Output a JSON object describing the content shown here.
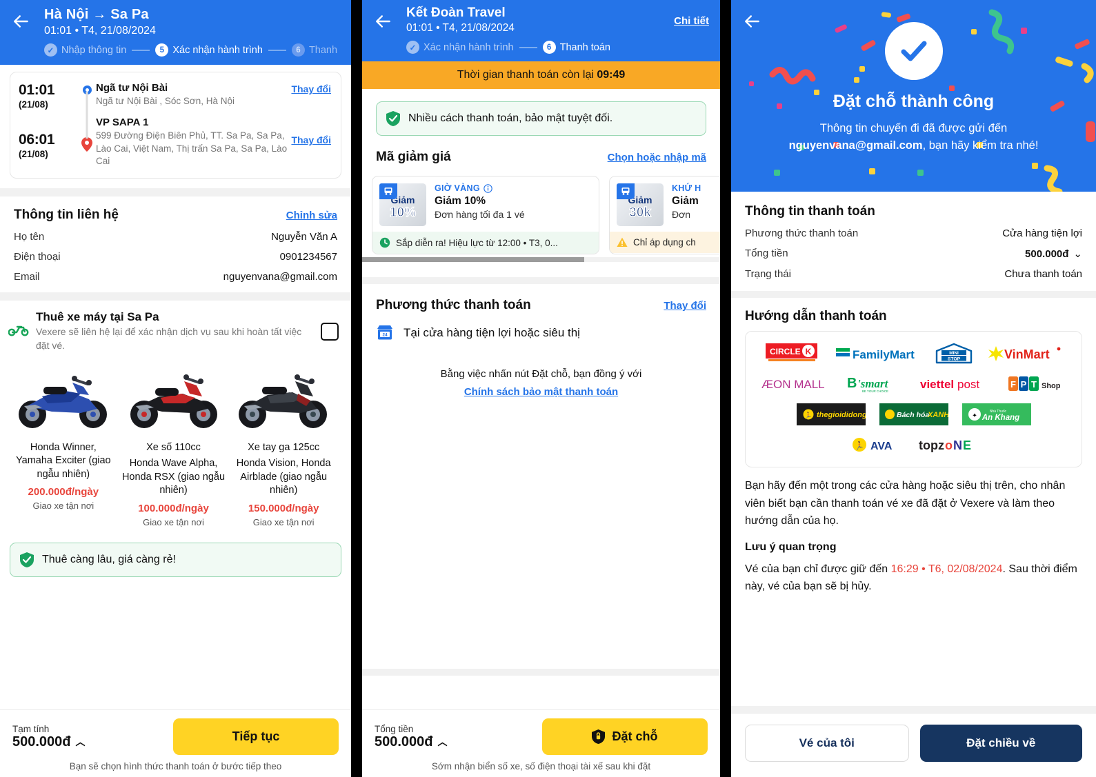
{
  "panel1": {
    "header": {
      "back_icon": "arrow-left-icon",
      "title": "Hà Nội → Sa Pa",
      "subtitle": "01:01 • T4, 21/08/2024",
      "steps": [
        {
          "label": "Nhập thông tin",
          "marker": "✓",
          "state": "done"
        },
        {
          "label": "Xác nhận hành trình",
          "marker": "5",
          "state": "active"
        },
        {
          "label": "Thanh",
          "marker": "6",
          "state": "todo"
        }
      ]
    },
    "trip": {
      "pickup": {
        "time": "01:01",
        "date": "(21/08)",
        "name": "Ngã tư Nội Bài",
        "address": "Ngã tư Nội Bài , Sóc Sơn, Hà Nội",
        "change_label": "Thay đổi"
      },
      "dropoff": {
        "time": "06:01",
        "date": "(21/08)",
        "name": "VP SAPA 1",
        "address": "599 Đường Điện Biên Phủ, TT. Sa Pa, Sa Pa, Lào Cai, Việt Nam, Thị trấn Sa Pa, Sa Pa, Lào Cai",
        "change_label": "Thay đổi"
      }
    },
    "contact": {
      "title": "Thông tin liên hệ",
      "edit_label": "Chỉnh sửa",
      "rows": [
        {
          "label": "Họ tên",
          "value": "Nguyễn Văn A"
        },
        {
          "label": "Điện thoại",
          "value": "0901234567"
        },
        {
          "label": "Email",
          "value": "nguyenvana@gmail.com"
        }
      ]
    },
    "rental": {
      "icon": "motorbike-icon",
      "title": "Thuê xe máy tại Sa Pa",
      "description": "Vexere sẽ liên hệ lại để xác nhận dịch vụ sau khi hoàn tất việc đặt vé.",
      "checkbox_checked": false,
      "bikes": [
        {
          "name": "Honda Winner, Yamaha Exciter (giao ngẫu nhiên)",
          "price": "200.000đ/ngày",
          "delivery": "Giao xe tận nơi",
          "color": "#2d4fb0",
          "image": "motorbike-blue-image"
        },
        {
          "name": "Xe số 110cc",
          "name2": "Honda Wave Alpha, Honda RSX (giao ngẫu nhiên)",
          "price": "100.000đ/ngày",
          "delivery": "Giao xe tận nơi",
          "color": "#c62828",
          "image": "motorbike-red-image"
        },
        {
          "name": "Xe tay ga 125cc",
          "name2": "Honda Vision, Honda Airblade (giao ngẫu nhiên)",
          "price": "150.000đ/ngày",
          "delivery": "Giao xe tận nơi",
          "color": "#37474f",
          "image": "motorbike-dark-image"
        }
      ],
      "note": "Thuê càng lâu, giá càng rẻ!",
      "note_icon": "shield-check-icon"
    },
    "bottom": {
      "amount_label": "Tạm tính",
      "amount": "500.000đ",
      "caret": "︿",
      "cta": "Tiếp tục",
      "footnote": "Bạn sẽ chọn hình thức thanh toán ở bước tiếp theo"
    }
  },
  "panel2": {
    "header": {
      "back_icon": "arrow-left-icon",
      "title": "Kết Đoàn Travel",
      "subtitle": "01:01 • T4, 21/08/2024",
      "detail_link": "Chi tiết",
      "steps": [
        {
          "label": "Xác nhận hành trình",
          "marker": "✓",
          "state": "done"
        },
        {
          "label": "Thanh toán",
          "marker": "6",
          "state": "active"
        }
      ]
    },
    "timer": {
      "prefix": "Thời gian thanh toán còn lại ",
      "value": "09:49"
    },
    "security_note": {
      "icon": "shield-check-icon",
      "text": "Nhiều cách thanh toán, bảo mật tuyệt đối."
    },
    "vouchers": {
      "title": "Mã giảm giá",
      "action_link": "Chọn hoặc nhập mã",
      "items": [
        {
          "thumb_line1": "Giảm",
          "thumb_line2": "10%",
          "tag": "GIỜ VÀNG",
          "tag_icon": "info-icon",
          "name": "Giảm 10%",
          "desc": "Đơn hàng tối đa 1 vé",
          "footer_icon": "clock-icon",
          "footer": "Sắp diễn ra! Hiệu lực từ 12:00 • T3, 0...",
          "footer_style": "green"
        },
        {
          "thumb_line1": "Giảm",
          "thumb_line2": "30k",
          "tag": "KHỨ H",
          "tag_icon": "info-icon",
          "name": "Giảm",
          "desc": "Đơn",
          "footer_icon": "warning-icon",
          "footer": "Chỉ áp dụng ch",
          "footer_style": "amber"
        }
      ]
    },
    "payment_method": {
      "title": "Phương thức thanh toán",
      "change_link": "Thay đổi",
      "icon": "convenience-store-icon",
      "label": "Tại cửa hàng tiện lợi hoặc siêu thị",
      "agree_text": "Bằng việc nhấn nút Đặt chỗ, bạn đồng ý với",
      "policy_link": "Chính sách bảo mật thanh toán"
    },
    "bottom": {
      "amount_label": "Tổng tiền",
      "amount": "500.000đ",
      "caret": "︿",
      "cta": "Đặt chỗ",
      "cta_icon": "shield-lock-icon",
      "footnote": "Sớm nhận biển số xe, số điện thoại tài xế sau khi đặt"
    }
  },
  "panel3": {
    "hero": {
      "back_icon": "arrow-left-icon",
      "check_icon": "check-circle-icon",
      "title": "Đặt chỗ thành công",
      "subtitle_prefix": "Thông tin chuyến đi đã được gửi đến",
      "email": "nguyenvana@gmail.com",
      "subtitle_suffix": ", bạn hãy kiểm tra nhé!"
    },
    "payment_info": {
      "title": "Thông tin thanh toán",
      "rows": [
        {
          "label": "Phương thức thanh toán",
          "value": "Cửa hàng tiện lợi",
          "style": "normal"
        },
        {
          "label": "Tổng tiền",
          "value": "500.000đ",
          "style": "bold",
          "caret": "⌄"
        },
        {
          "label": "Trạng thái",
          "value": "Chưa thanh toán",
          "style": "red"
        }
      ]
    },
    "instructions": {
      "title": "Hướng dẫn thanh toán",
      "logos": [
        [
          {
            "name": "CIRCLE K",
            "id": "circle-k-logo"
          },
          {
            "name": "FamilyMart",
            "id": "familymart-logo"
          },
          {
            "name": "MINI STOP",
            "id": "ministop-logo"
          },
          {
            "name": "VinMart",
            "id": "vinmart-logo"
          }
        ],
        [
          {
            "name": "ÆON MALL",
            "id": "aeon-mall-logo"
          },
          {
            "name": "B'smart",
            "id": "bsmart-logo"
          },
          {
            "name": "viettel post",
            "id": "viettel-post-logo"
          },
          {
            "name": "FPT Shop",
            "id": "fpt-shop-logo"
          }
        ],
        [
          {
            "name": "thegioididong",
            "id": "thegioididong-logo"
          },
          {
            "name": "Bách hóa XANH",
            "id": "bach-hoa-xanh-logo"
          },
          {
            "name": "An Khang",
            "id": "an-khang-logo"
          }
        ],
        [
          {
            "name": "AVA",
            "id": "ava-logo"
          },
          {
            "name": "topzone",
            "id": "topzone-logo"
          }
        ]
      ],
      "paragraph": "Bạn hãy đến một trong các cửa hàng hoặc siêu thị trên, cho nhân viên biết bạn cần thanh toán vé xe đã đặt ở Vexere và làm theo hướng dẫn của họ.",
      "note_title": "Lưu ý quan trọng",
      "note_prefix": "Vé của bạn chỉ được giữ đến ",
      "note_deadline": "16:29 • T6, 02/08/2024",
      "note_suffix": ". Sau thời điểm này, vé của bạn sẽ bị hủy."
    },
    "bottom": {
      "secondary_cta": "Vé của tôi",
      "primary_cta": "Đặt chiều về"
    }
  },
  "colors": {
    "brand_blue": "#2574e8",
    "accent_yellow": "#ffd324",
    "amber": "#f9a825",
    "red": "#e8453c",
    "navy": "#163560",
    "green": "#1aa260"
  }
}
